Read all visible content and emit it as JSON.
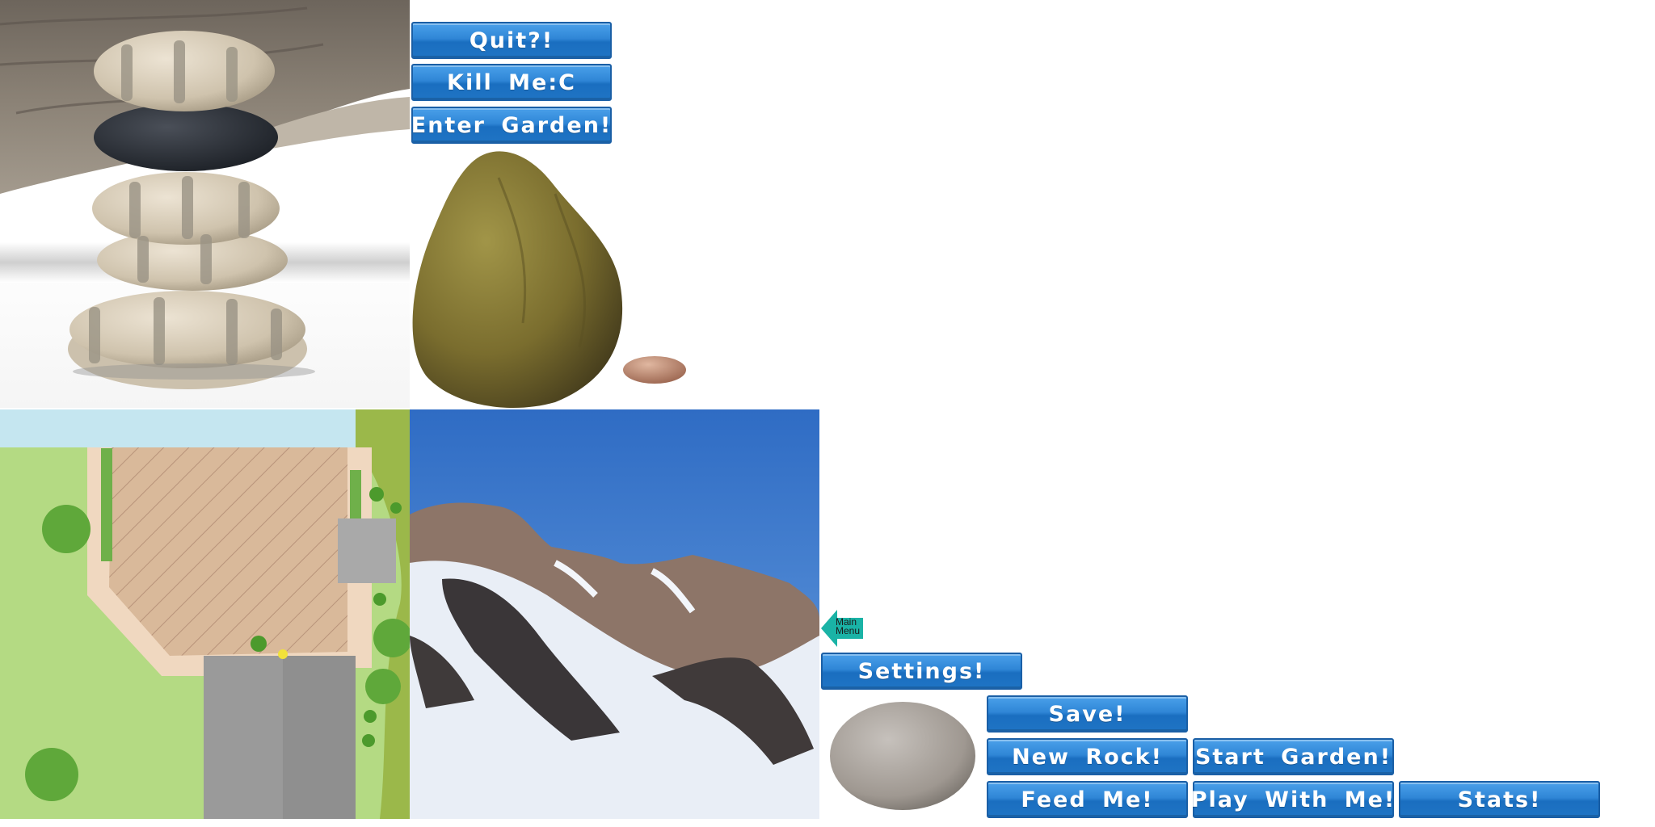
{
  "menu": {
    "quit_label": "Quit?!",
    "kill_label": "Kill Me:C",
    "enter_garden_label": "Enter Garden!",
    "settings_label": "Settings!",
    "save_label": "Save!",
    "new_rock_label": "New Rock!",
    "start_garden_label": "Start Garden!",
    "feed_label": "Feed Me!",
    "play_label": "Play With Me!",
    "stats_label": "Stats!",
    "main_menu_label_line1": "Main",
    "main_menu_label_line2": "Menu"
  },
  "colors": {
    "button_blue": "#2f86d6",
    "arrow_teal": "#1ab3a6",
    "sky_blue": "#3a78c8",
    "lawn_green": "#b4da83"
  }
}
